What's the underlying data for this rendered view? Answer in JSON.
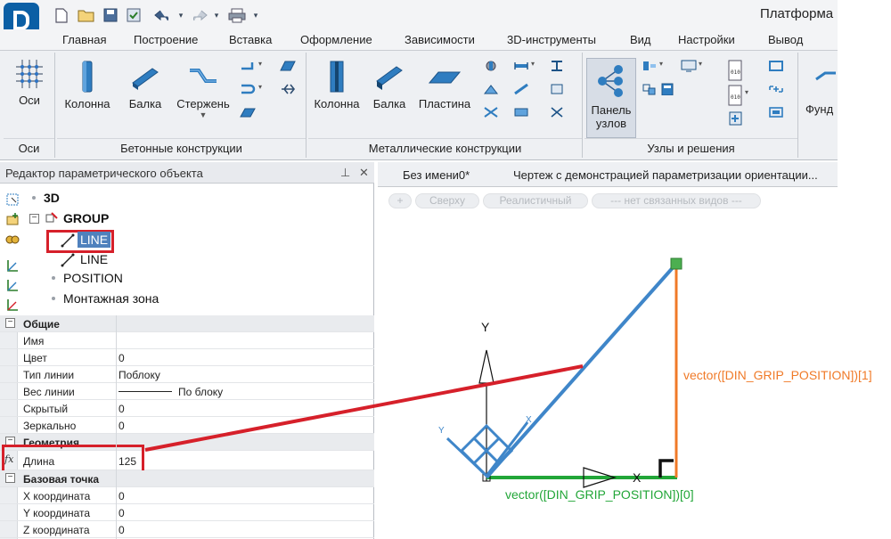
{
  "app": {
    "title": "Платформа"
  },
  "menu": [
    "Главная",
    "Построение",
    "Вставка",
    "Оформление",
    "Зависимости",
    "3D-инструменты",
    "Вид",
    "Настройки",
    "Вывод"
  ],
  "ribbon": {
    "axes_group": {
      "title": "Оси",
      "button": "Оси"
    },
    "concrete_group": {
      "title": "Бетонные конструкции",
      "buttons": [
        "Колонна",
        "Балка",
        "Стержень"
      ]
    },
    "metal_group": {
      "title": "Металлические конструкции",
      "buttons": [
        "Колонна",
        "Балка",
        "Пластина"
      ]
    },
    "nodes_group": {
      "title": "Узлы и решения",
      "node_panel_line1": "Панель",
      "node_panel_line2": "узлов"
    },
    "partial_button": "Фунд"
  },
  "left_panel": {
    "title": "Редактор параметрического объекта",
    "tree": {
      "root": "3D",
      "group": "GROUP",
      "line1": "LINE",
      "line2": "LINE",
      "position": "POSITION",
      "zone": "Монтажная зона"
    },
    "properties": {
      "general_title": "Общие",
      "general": [
        {
          "name": "Имя",
          "value": ""
        },
        {
          "name": "Цвет",
          "value": "0"
        },
        {
          "name": "Тип линии",
          "value": "Поблоку"
        },
        {
          "name": "Вес линии",
          "value": "По блоку"
        },
        {
          "name": "Скрытый",
          "value": "0"
        },
        {
          "name": "Зеркально",
          "value": "0"
        }
      ],
      "geometry_title": "Геометрия",
      "length": {
        "name": "Длина",
        "value": "125"
      },
      "base_point_title": "Базовая точка",
      "base_point": [
        {
          "name": "X координата",
          "value": "0"
        },
        {
          "name": "Y координата",
          "value": "0"
        },
        {
          "name": "Z координата",
          "value": "0"
        }
      ]
    }
  },
  "drawing": {
    "tabs": [
      "Без имени0*",
      "Чертеж с демонстрацией параметризации ориентации..."
    ],
    "pills": [
      "+",
      "Сверху",
      "Реалистичный",
      "--- нет связанных видов ---"
    ],
    "axis_y": "Y",
    "axis_x": "X",
    "label_y": "vector([DIN_GRIP_POSITION])[1]",
    "label_x": "vector([DIN_GRIP_POSITION])[0]"
  },
  "colors": {
    "highlight_red": "#d6202a",
    "line_blue": "#3f86c9",
    "vector_orange": "#f07a28",
    "vector_green": "#22a638",
    "grip_green": "#4caf50",
    "brand_blue": "#0b5fa5"
  }
}
